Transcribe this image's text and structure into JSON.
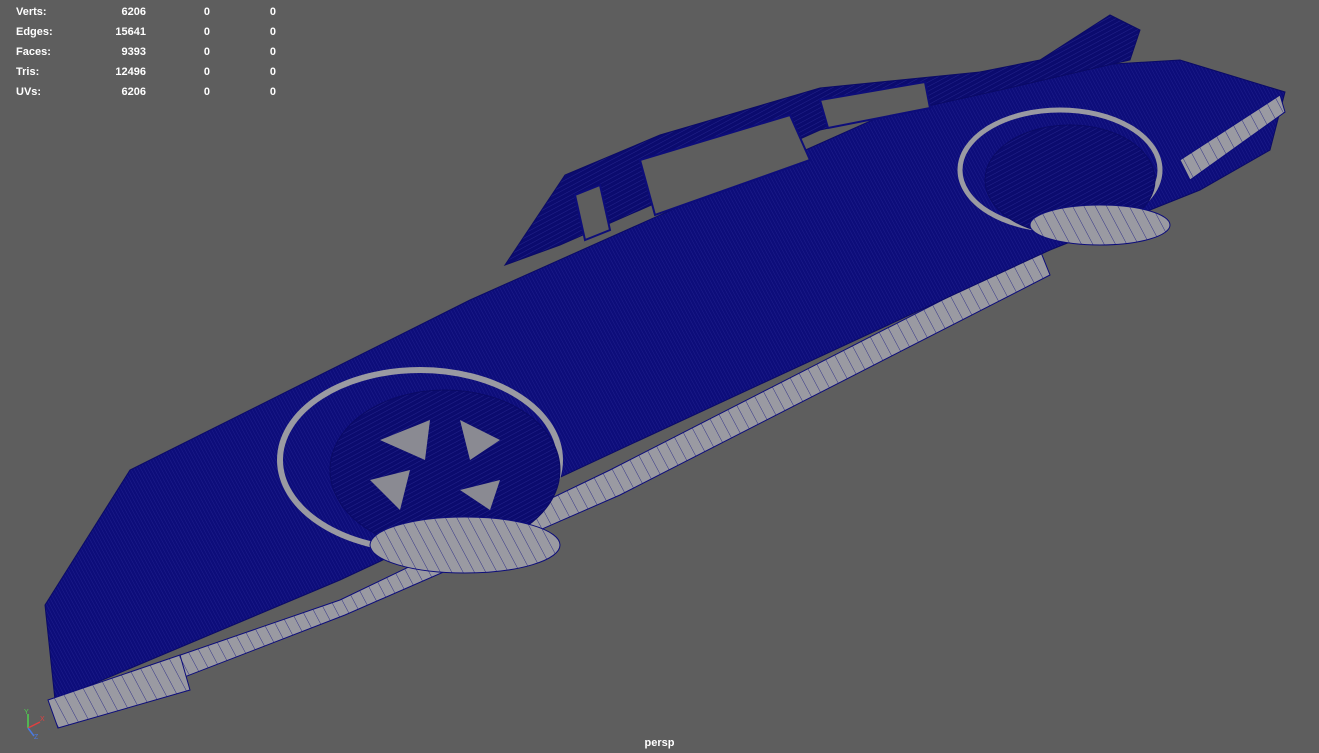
{
  "hud": {
    "rows": [
      {
        "label": "Verts:",
        "values": [
          "6206",
          "0",
          "0"
        ]
      },
      {
        "label": "Edges:",
        "values": [
          "15641",
          "0",
          "0"
        ]
      },
      {
        "label": "Faces:",
        "values": [
          "9393",
          "0",
          "0"
        ]
      },
      {
        "label": "Tris:",
        "values": [
          "12496",
          "0",
          "0"
        ]
      },
      {
        "label": "UVs:",
        "values": [
          "6206",
          "0",
          "0"
        ]
      }
    ]
  },
  "viewport": {
    "camera": "persp",
    "background_color": "#5e5e5e",
    "wire_color": "#0d0d7a",
    "face_color": "#9a9aa2"
  },
  "axis_gizmo": {
    "y_label": "Y",
    "x_label": "X",
    "z_label": "Z"
  }
}
